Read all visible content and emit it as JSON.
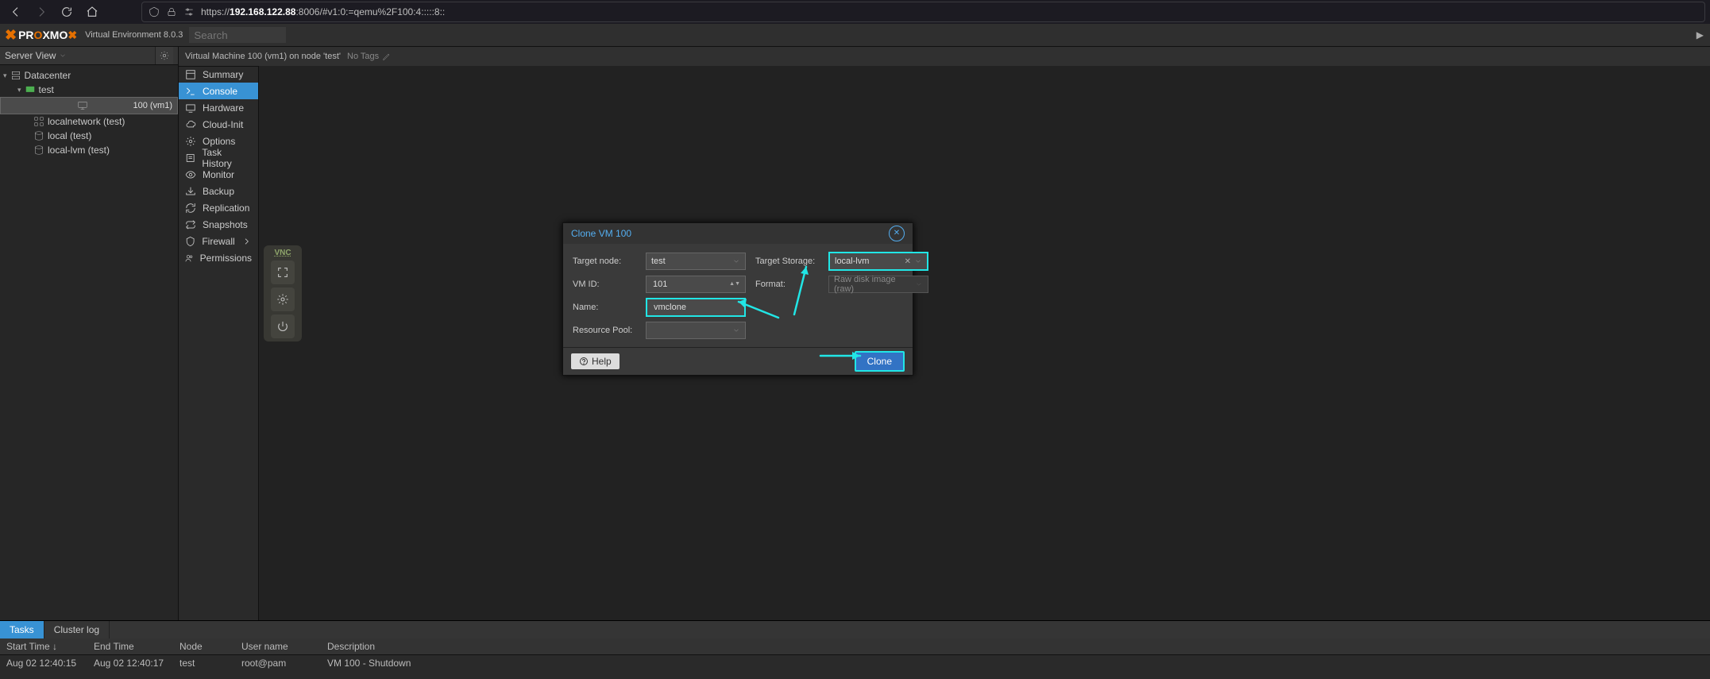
{
  "browser": {
    "url_prefix": "https://",
    "url_host": "192.168.122.88",
    "url_suffix": ":8006/#v1:0:=qemu%2F100:4:::::8::"
  },
  "header": {
    "product": "PROXMOX",
    "env": "Virtual Environment 8.0.3",
    "search_placeholder": "Search"
  },
  "tree": {
    "view_label": "Server View",
    "datacenter": "Datacenter",
    "node": "test",
    "items": [
      {
        "label": "100 (vm1)"
      },
      {
        "label": "localnetwork (test)"
      },
      {
        "label": "local (test)"
      },
      {
        "label": "local-lvm (test)"
      }
    ]
  },
  "content": {
    "breadcrumb": "Virtual Machine 100 (vm1) on node 'test'",
    "no_tags": "No Tags",
    "tabs": [
      "Summary",
      "Console",
      "Hardware",
      "Cloud-Init",
      "Options",
      "Task History",
      "Monitor",
      "Backup",
      "Replication",
      "Snapshots",
      "Firewall",
      "Permissions"
    ],
    "active_tab": "Console",
    "vnc_label": "VNC"
  },
  "modal": {
    "title": "Clone VM 100",
    "left_labels": [
      "Target node:",
      "VM ID:",
      "Name:",
      "Resource Pool:"
    ],
    "right_labels": [
      "Target Storage:",
      "Format:"
    ],
    "target_node": "test",
    "vm_id": "101",
    "name": "vmclone",
    "resource_pool": "",
    "target_storage": "local-lvm",
    "format": "Raw disk image (raw)",
    "help": "Help",
    "clone": "Clone"
  },
  "bottom": {
    "tabs": [
      "Tasks",
      "Cluster log"
    ],
    "active": "Tasks",
    "columns": [
      "Start Time ↓",
      "End Time",
      "Node",
      "User name",
      "Description"
    ],
    "row": {
      "start": "Aug 02 12:40:15",
      "end": "Aug 02 12:40:17",
      "node": "test",
      "user": "root@pam",
      "desc": "VM 100 - Shutdown"
    }
  }
}
